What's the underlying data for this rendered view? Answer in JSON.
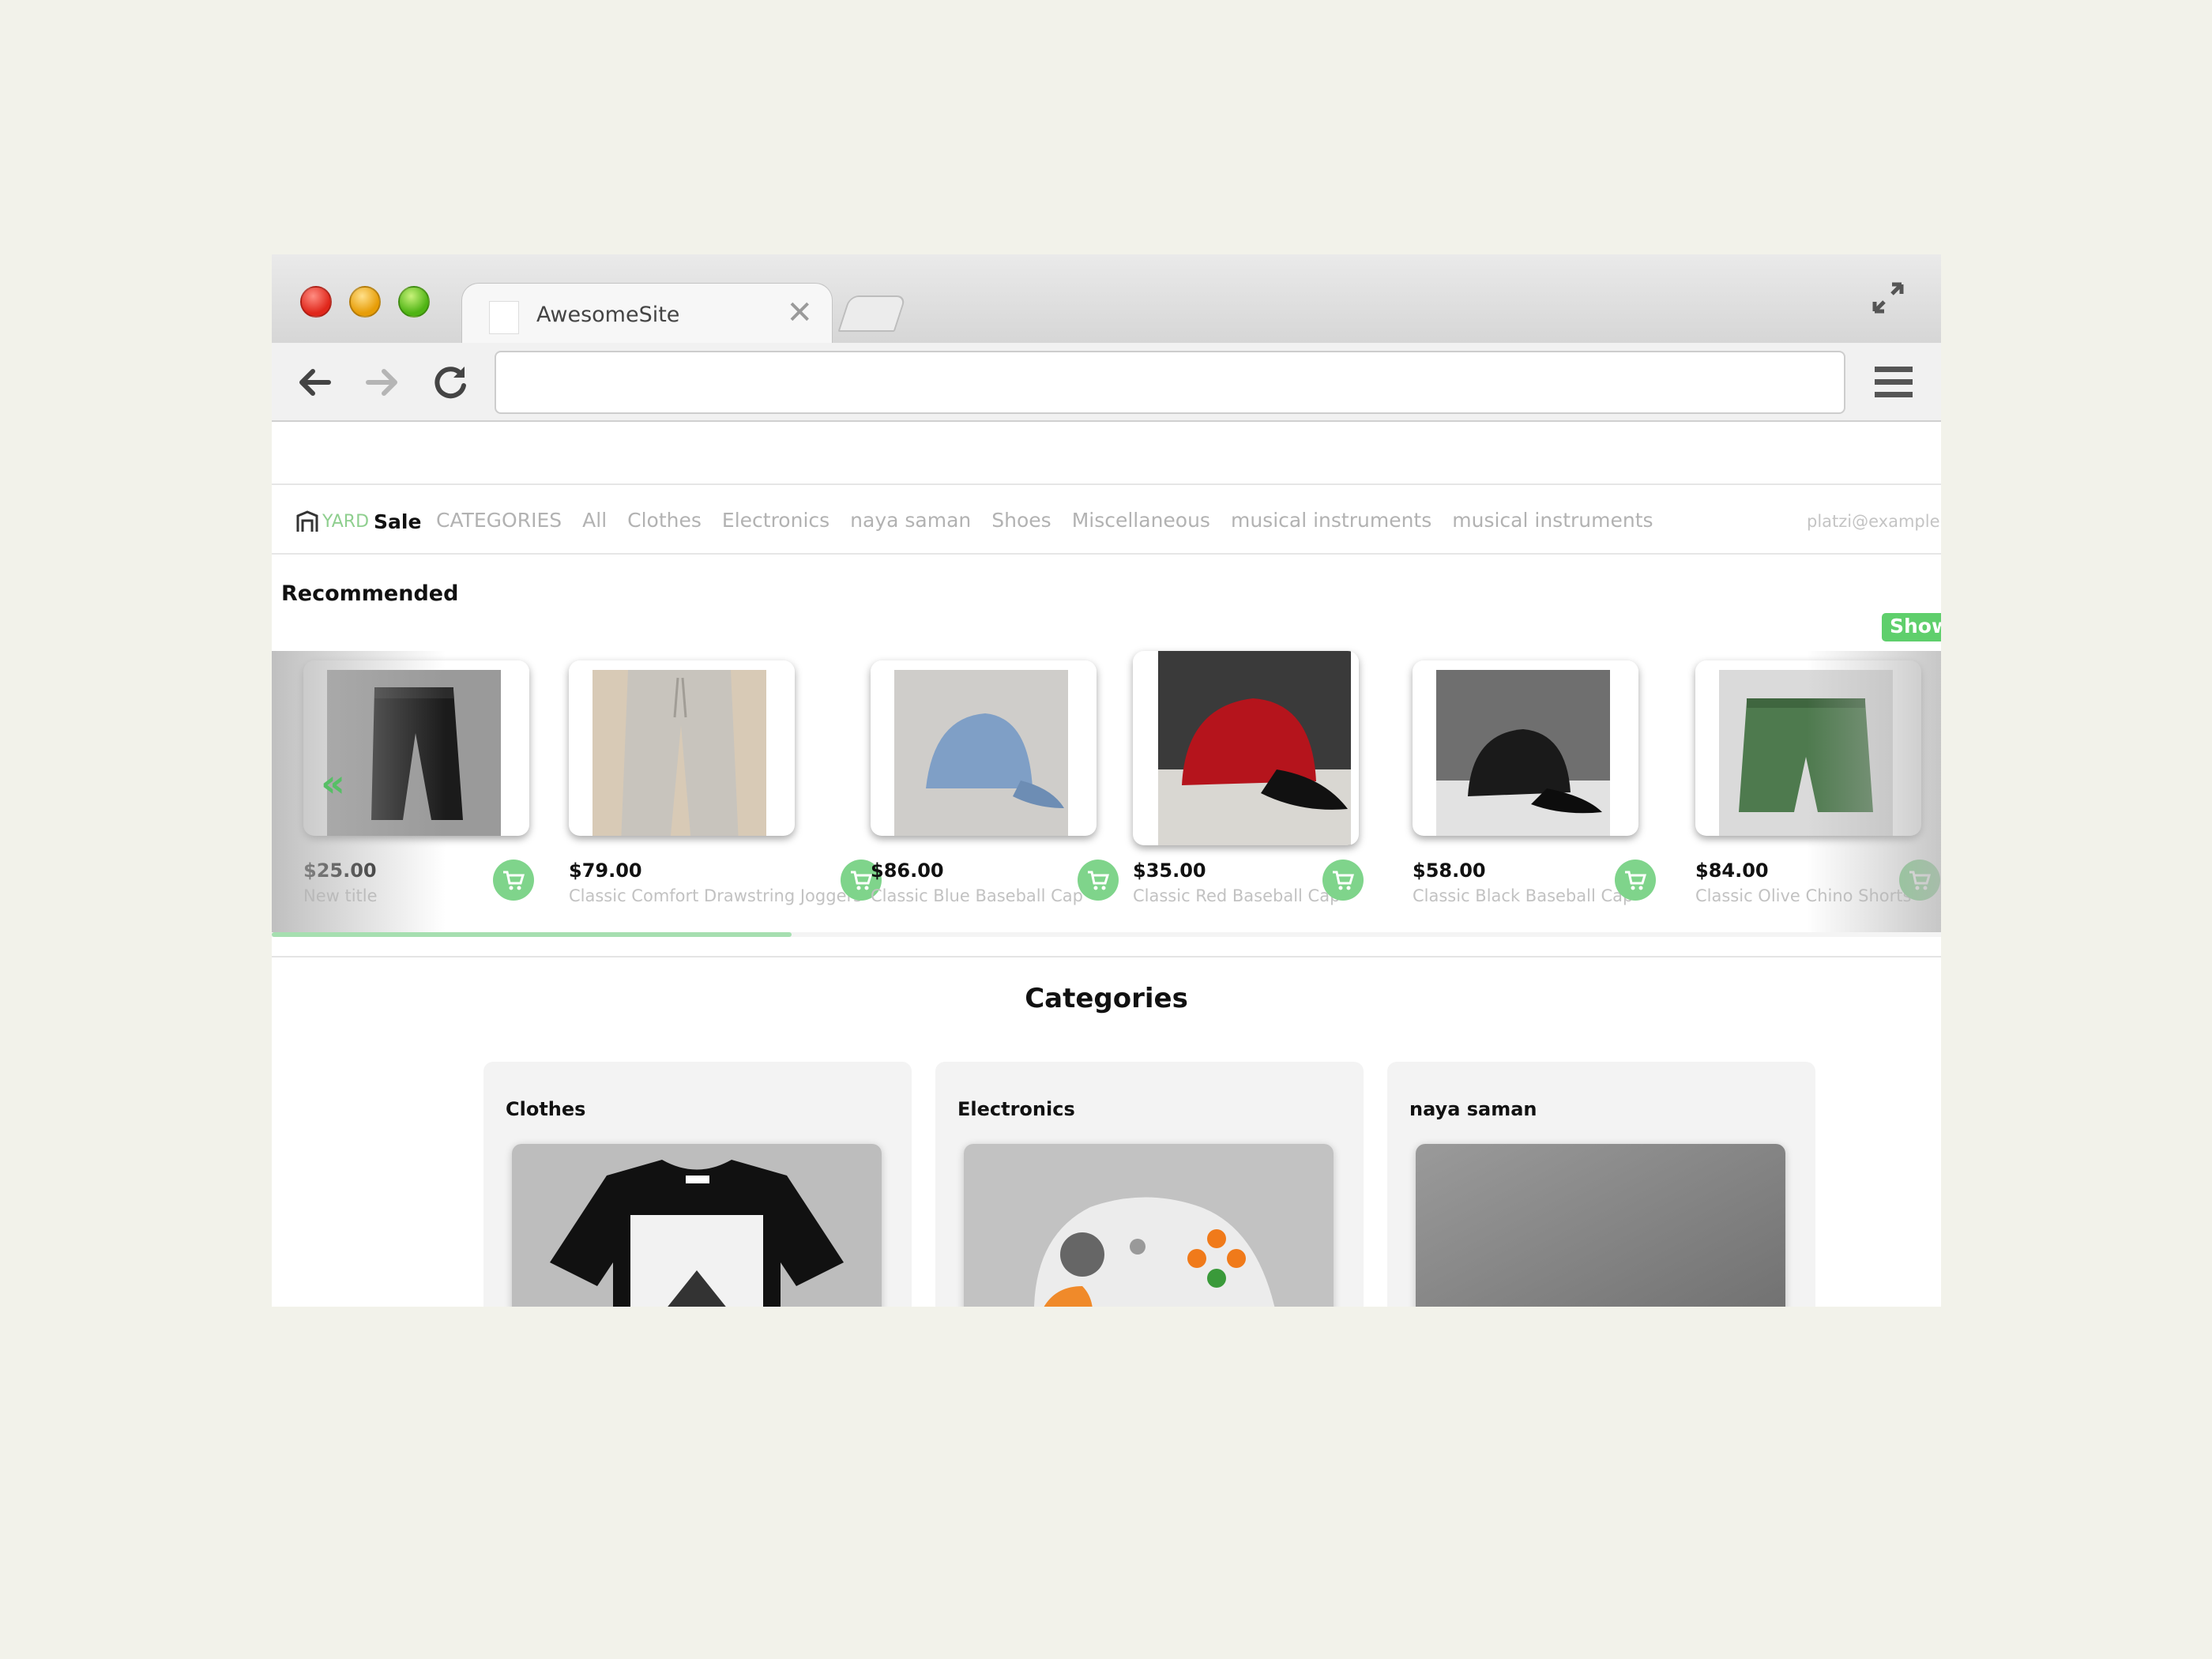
{
  "browser": {
    "tab_title": "AwesomeSite",
    "url": ""
  },
  "site": {
    "logo_yard": "YARD",
    "logo_sale": "Sale",
    "nav_links": [
      "CATEGORIES",
      "All",
      "Clothes",
      "Electronics",
      "naya saman",
      "Shoes",
      "Miscellaneous",
      "musical instruments",
      "musical instruments"
    ],
    "user_email": "platzi@example.co"
  },
  "recommended": {
    "title": "Recommended",
    "show_button": "Show",
    "products": [
      {
        "price": "$25.00",
        "title": "New title",
        "image": "black-joggers-photo"
      },
      {
        "price": "$79.00",
        "title": "Classic Comfort Drawstring Joggers",
        "image": "grey-joggers-photo"
      },
      {
        "price": "$86.00",
        "title": "Classic Blue Baseball Cap",
        "image": "blue-cap-photo"
      },
      {
        "price": "$35.00",
        "title": "Classic Red Baseball Cap",
        "image": "red-cap-photo"
      },
      {
        "price": "$58.00",
        "title": "Classic Black Baseball Cap",
        "image": "black-cap-photo"
      },
      {
        "price": "$84.00",
        "title": "Classic Olive Chino Shorts",
        "image": "olive-shorts-photo"
      }
    ]
  },
  "categories": {
    "title": "Categories",
    "items": [
      {
        "name": "Clothes",
        "image": "tshirt-photo"
      },
      {
        "name": "Electronics",
        "image": "controller-photo"
      },
      {
        "name": "naya saman",
        "image": "grey-placeholder-photo"
      }
    ]
  },
  "colors": {
    "accent_green": "#5fcf6c",
    "cart_green": "#7fd48b"
  }
}
